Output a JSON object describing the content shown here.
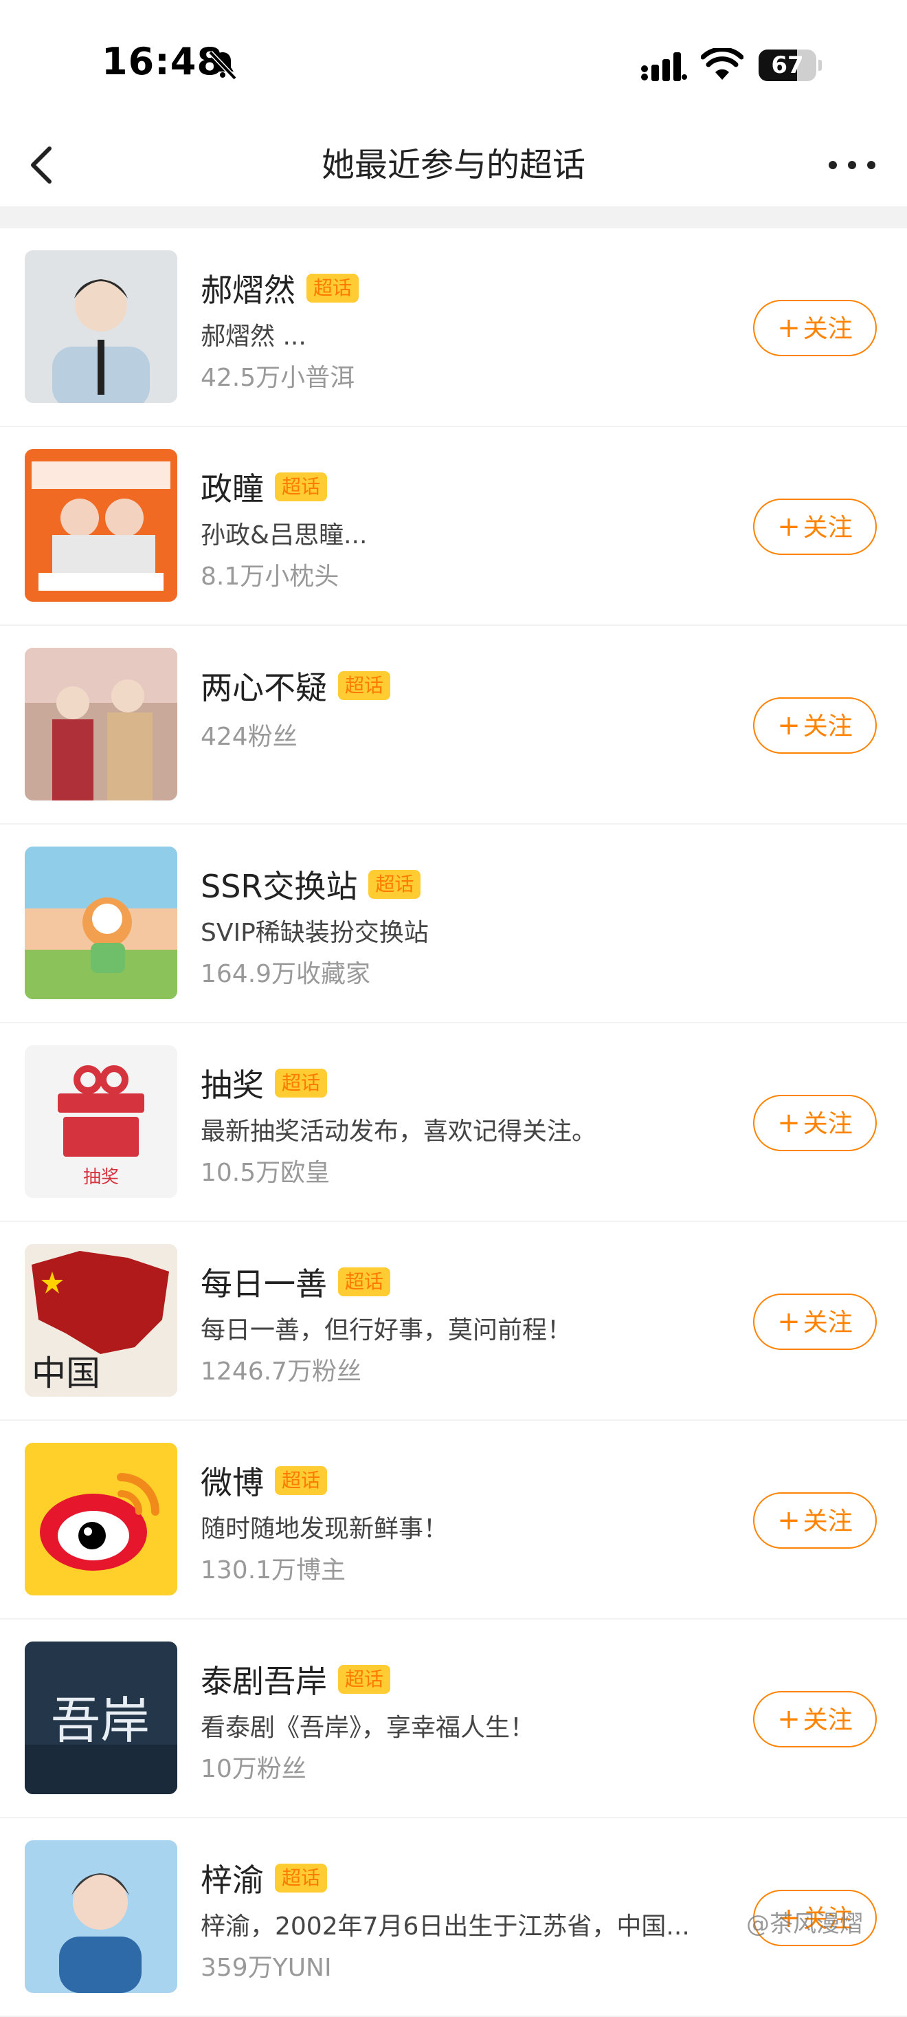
{
  "status_bar": {
    "time": "16:48",
    "battery_level": "67",
    "icons": [
      "bell-slash-icon",
      "cellular-signal-icon",
      "wifi-icon",
      "battery-icon"
    ]
  },
  "nav": {
    "title": "她最近参与的超话",
    "icons": [
      "chevron-left-icon",
      "more-horizontal-icon"
    ]
  },
  "colors": {
    "accent": "#ff8200",
    "badge_bg": "#ffcc33",
    "badge_text": "#ff7a00"
  },
  "badge_label": "超话",
  "follow_label": "关注",
  "items": [
    {
      "name": "郝熠然",
      "desc": "郝熠然 ...",
      "fans": "42.5万小普洱",
      "badge": true,
      "follow": true
    },
    {
      "name": "政瞳",
      "desc": "孙政&吕思瞳...",
      "fans": "8.1万小枕头",
      "badge": true,
      "follow": true
    },
    {
      "name": "两心不疑",
      "desc": "",
      "fans": "424粉丝",
      "badge": true,
      "follow": true
    },
    {
      "name": "SSR交换站",
      "desc": "SVIP稀缺装扮交换站",
      "fans": "164.9万收藏家",
      "badge": true,
      "follow": false
    },
    {
      "name": "抽奖",
      "desc": "最新抽奖活动发布，喜欢记得关注。",
      "fans": "10.5万欧皇",
      "badge": true,
      "follow": true,
      "thumb_text": "抽奖"
    },
    {
      "name": "每日一善",
      "desc": "每日一善，但行好事，莫问前程！",
      "fans": "1246.7万粉丝",
      "badge": true,
      "follow": true,
      "thumb_text": "中国"
    },
    {
      "name": "微博",
      "desc": "随时随地发现新鲜事！",
      "fans": "130.1万博主",
      "badge": true,
      "follow": true
    },
    {
      "name": "泰剧吾岸",
      "desc": "看泰剧《吾岸》，享幸福人生！",
      "fans": "10万粉丝",
      "badge": true,
      "follow": true,
      "thumb_text": "吾岸"
    },
    {
      "name": "梓渝",
      "desc": "梓渝，2002年7月6日出生于江苏省，中国...",
      "fans": "359万YUNI",
      "badge": true,
      "follow": true
    }
  ],
  "watermark": "@茶风漫熠"
}
